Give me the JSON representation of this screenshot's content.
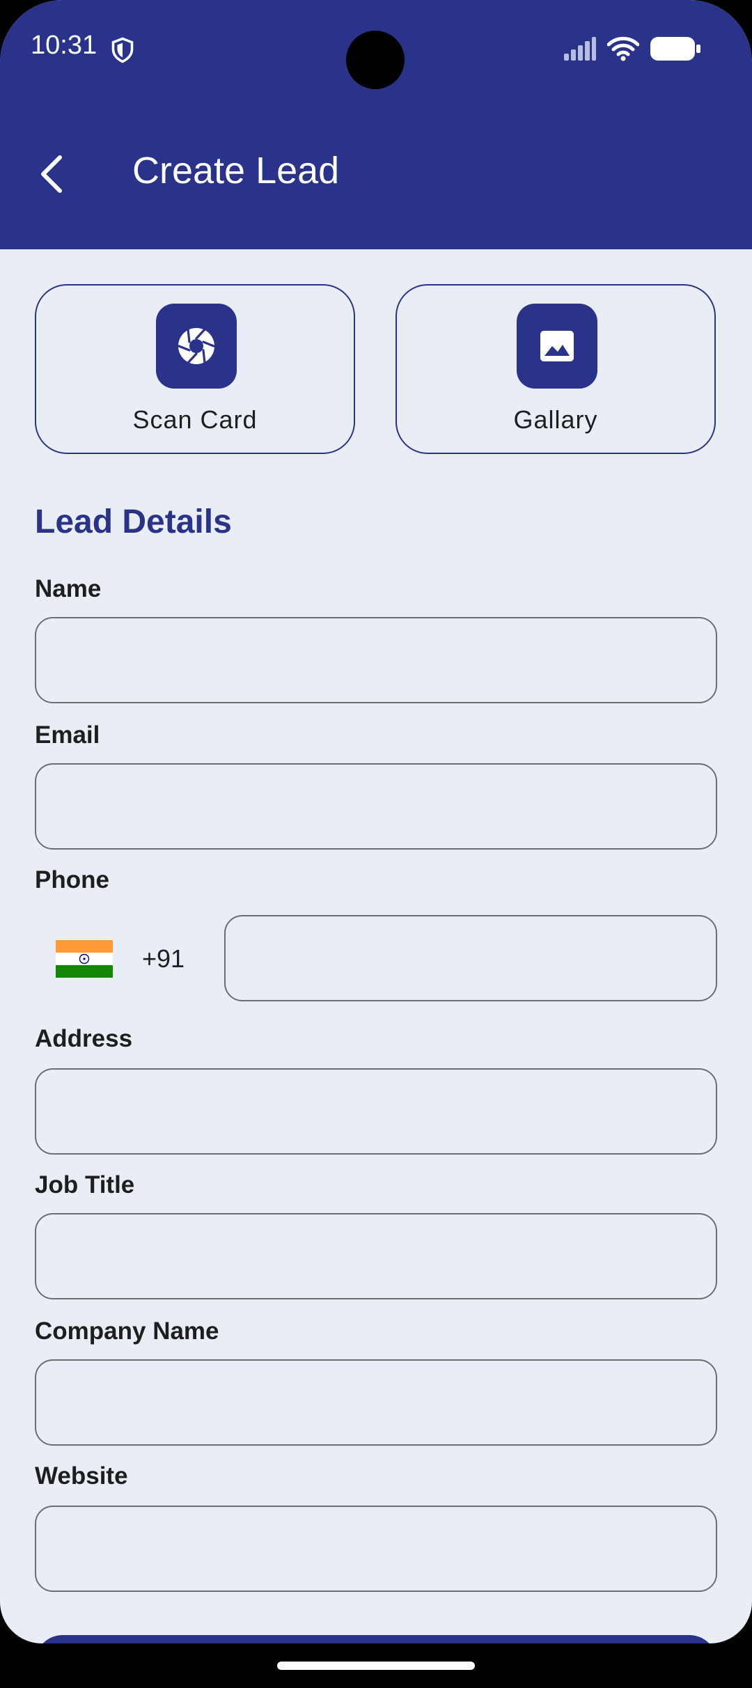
{
  "status_bar": {
    "time": "10:31",
    "shield_icon": "shield-icon",
    "signal_icon": "signal-icon",
    "wifi_icon": "wifi-icon",
    "battery_icon": "battery-icon"
  },
  "header": {
    "title": "Create Lead",
    "back_icon": "chevron-left-icon"
  },
  "actions": {
    "scan_card": {
      "label": "Scan Card",
      "icon": "camera-shutter-icon"
    },
    "gallery": {
      "label": "Gallary",
      "icon": "image-icon"
    }
  },
  "form": {
    "section_title": "Lead Details",
    "fields": {
      "name": {
        "label": "Name",
        "value": ""
      },
      "email": {
        "label": "Email",
        "value": ""
      },
      "phone": {
        "label": "Phone",
        "value": "",
        "dial_code": "+91"
      },
      "address": {
        "label": "Address",
        "value": ""
      },
      "job_title": {
        "label": "Job Title",
        "value": ""
      },
      "company_name": {
        "label": "Company Name",
        "value": ""
      },
      "website": {
        "label": "Website",
        "value": ""
      }
    }
  },
  "colors": {
    "primary": "#283389",
    "background": "#E9EDF5",
    "field_border": "#6E6E6E",
    "text": "#1E1E1E"
  }
}
